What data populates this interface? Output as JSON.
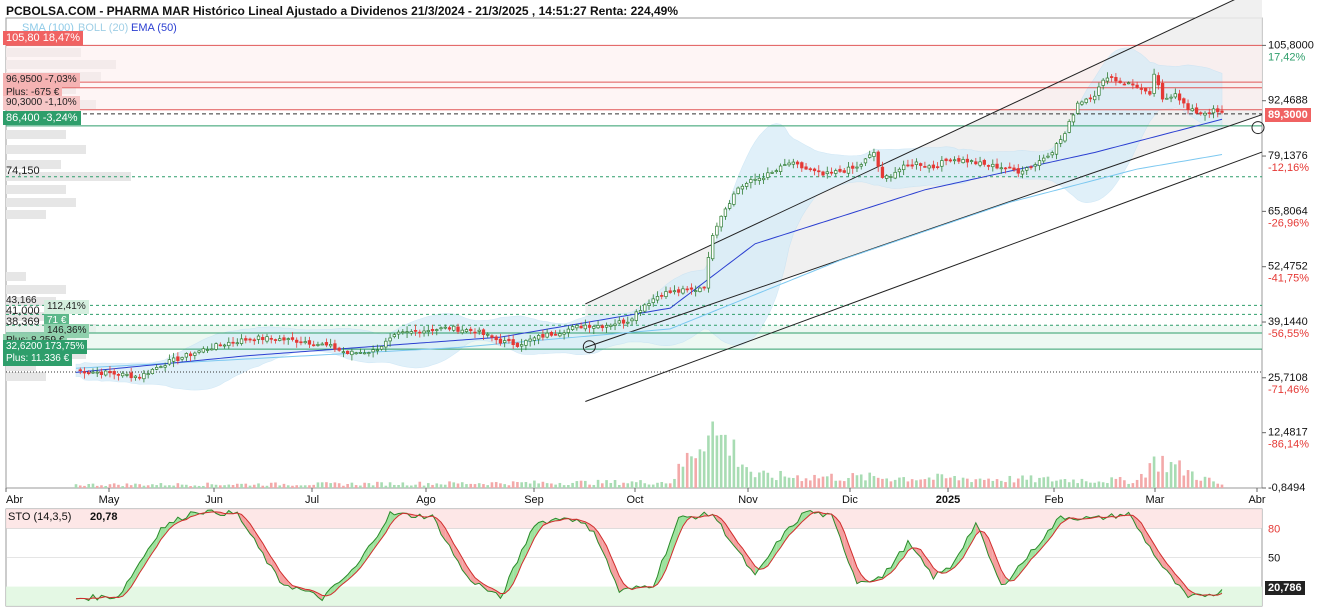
{
  "header": {
    "title": "PCBOLSA.COM - PHARMA MAR Histórico Lineal Ajustado a Dividenos 21/3/2024 - 21/3/2025 , 14:51:27 Renta: 224,49%"
  },
  "indicators": {
    "sma": "SMA (100)",
    "boll": "BOLL (20)",
    "ema": "EMA (50)"
  },
  "colors": {
    "up": "#2e7d32",
    "down": "#e53935",
    "ema": "#2b3fd1",
    "sma": "#7cc8f0",
    "boll": "#bfe2f5",
    "accent_green": "#2e9e6b",
    "accent_red": "#f06262"
  },
  "tags": {
    "top_red": "105,80  18,47%",
    "p_96": "96,9500  -7,03%",
    "plus_675": "Plus: -675 €",
    "p_90": "90,3000  -1,10%",
    "current_green": "86,400  -3,24%",
    "p_74": "74,150",
    "p_43": "43,166",
    "pct_112": "112,41%",
    "p_41": "41,000",
    "p_38": "38,369",
    "pct_71": "71 €",
    "pct_146": "146,36%",
    "plus_8259": "Plus: 8.259 €",
    "p_32": "32,6200  173,75%",
    "plus_11336": "Plus: 11.336 €",
    "right_current": "89,3000"
  },
  "right_axis": {
    "labels": [
      {
        "value": "105,8000",
        "pct": "17,42%",
        "pct_color": "green"
      },
      {
        "value": "92,4688",
        "pct": "2,62%",
        "pct_color": "green"
      },
      {
        "value": "79,1376",
        "pct": "-12,16%",
        "pct_color": "red"
      },
      {
        "value": "65,8064",
        "pct": "-26,96%",
        "pct_color": "red"
      },
      {
        "value": "52,4752",
        "pct": "-41,75%",
        "pct_color": "red"
      },
      {
        "value": "39,1440",
        "pct": "-56,55%",
        "pct_color": "red"
      },
      {
        "value": "25,7108",
        "pct": "-71,46%",
        "pct_color": "red"
      },
      {
        "value": "12,4817",
        "pct": "-86,14%",
        "pct_color": "red"
      },
      {
        "value": "-0,8494",
        "pct": "",
        "pct_color": "red"
      }
    ]
  },
  "x_axis": {
    "labels": [
      "Abr",
      "May",
      "Jun",
      "Jul",
      "Ago",
      "Sep",
      "Oct",
      "Nov",
      "Dic",
      "2025",
      "Feb",
      "Mar",
      "Abr"
    ]
  },
  "stochastic": {
    "label": "STO (14,3,5)",
    "value": "20,78",
    "right_value": "20,786",
    "levels": [
      "80",
      "50"
    ]
  },
  "chart_data": {
    "type": "line",
    "title": "PHARMA MAR Histórico Lineal Ajustado a Dividenos",
    "ylim": [
      -0.8494,
      112.4
    ],
    "price_anchors": [
      [
        0,
        27.5
      ],
      [
        8,
        26.8
      ],
      [
        15,
        26.0
      ],
      [
        20,
        28.8
      ],
      [
        24,
        30.3
      ],
      [
        30,
        32.5
      ],
      [
        36,
        34.2
      ],
      [
        42,
        35.3
      ],
      [
        48,
        35.0
      ],
      [
        54,
        34.5
      ],
      [
        60,
        33.2
      ],
      [
        64,
        31.6
      ],
      [
        70,
        32.2
      ],
      [
        76,
        36.2
      ],
      [
        82,
        37.2
      ],
      [
        88,
        37.7
      ],
      [
        94,
        37.0
      ],
      [
        100,
        34.5
      ],
      [
        104,
        33.8
      ],
      [
        110,
        35.8
      ],
      [
        116,
        37.4
      ],
      [
        120,
        38.4
      ],
      [
        124,
        38.3
      ],
      [
        130,
        39.5
      ],
      [
        134,
        43.4
      ],
      [
        138,
        46.1
      ],
      [
        142,
        46.5
      ],
      [
        146,
        47.0
      ],
      [
        148,
        48.0
      ],
      [
        150,
        60.5
      ],
      [
        152,
        65.0
      ],
      [
        156,
        71.5
      ],
      [
        160,
        73.5
      ],
      [
        164,
        75.0
      ],
      [
        168,
        77.5
      ],
      [
        172,
        76.0
      ],
      [
        176,
        74.5
      ],
      [
        180,
        75.5
      ],
      [
        184,
        76.3
      ],
      [
        188,
        80.0
      ],
      [
        190,
        73.5
      ],
      [
        194,
        76.0
      ],
      [
        198,
        77.5
      ],
      [
        202,
        76.5
      ],
      [
        206,
        78.5
      ],
      [
        210,
        78.0
      ],
      [
        214,
        77.0
      ],
      [
        218,
        76.5
      ],
      [
        222,
        75.5
      ],
      [
        226,
        77.2
      ],
      [
        230,
        80.5
      ],
      [
        233,
        84.5
      ],
      [
        236,
        92.0
      ],
      [
        240,
        94.0
      ],
      [
        243,
        98.5
      ],
      [
        246,
        97.0
      ],
      [
        250,
        96.0
      ],
      [
        253,
        93.5
      ],
      [
        254,
        99.0
      ],
      [
        256,
        92.5
      ],
      [
        259,
        94.5
      ],
      [
        262,
        90.2
      ],
      [
        265,
        89.5
      ],
      [
        268,
        90.0
      ],
      [
        270,
        89.3
      ]
    ],
    "n_sessions": 271,
    "ema50_anchors": [
      [
        0,
        27.0
      ],
      [
        40,
        31.0
      ],
      [
        100,
        35.5
      ],
      [
        140,
        42.5
      ],
      [
        160,
        58.0
      ],
      [
        200,
        71.0
      ],
      [
        240,
        80.0
      ],
      [
        270,
        88.0
      ]
    ],
    "sma100_anchors": [
      [
        0,
        28.0
      ],
      [
        90,
        33.0
      ],
      [
        140,
        37.5
      ],
      [
        180,
        54.0
      ],
      [
        220,
        68.0
      ],
      [
        250,
        76.0
      ],
      [
        270,
        79.5
      ]
    ],
    "volume_anchors": [
      [
        0,
        5
      ],
      [
        60,
        6
      ],
      [
        140,
        9
      ],
      [
        150,
        95
      ],
      [
        160,
        18
      ],
      [
        250,
        11
      ],
      [
        254,
        45
      ],
      [
        270,
        4
      ]
    ],
    "stochastic_anchors": [
      [
        0,
        8
      ],
      [
        10,
        10
      ],
      [
        20,
        80
      ],
      [
        28,
        98
      ],
      [
        38,
        95
      ],
      [
        48,
        25
      ],
      [
        58,
        8
      ],
      [
        66,
        40
      ],
      [
        74,
        95
      ],
      [
        84,
        92
      ],
      [
        92,
        30
      ],
      [
        100,
        8
      ],
      [
        108,
        85
      ],
      [
        116,
        92
      ],
      [
        122,
        78
      ],
      [
        128,
        15
      ],
      [
        136,
        22
      ],
      [
        142,
        90
      ],
      [
        150,
        95
      ],
      [
        160,
        30
      ],
      [
        166,
        70
      ],
      [
        172,
        98
      ],
      [
        178,
        92
      ],
      [
        184,
        25
      ],
      [
        190,
        30
      ],
      [
        196,
        65
      ],
      [
        202,
        30
      ],
      [
        206,
        40
      ],
      [
        212,
        85
      ],
      [
        218,
        20
      ],
      [
        224,
        50
      ],
      [
        232,
        92
      ],
      [
        240,
        90
      ],
      [
        248,
        95
      ],
      [
        256,
        40
      ],
      [
        262,
        8
      ],
      [
        270,
        15
      ]
    ],
    "horizontal_levels": [
      {
        "value": 105.8,
        "style": "solid-red"
      },
      {
        "value": 96.95,
        "style": "solid-red"
      },
      {
        "value": 95.6,
        "style": "solid-red"
      },
      {
        "value": 90.3,
        "style": "solid-red"
      },
      {
        "value": 89.3,
        "style": "dashed-dark"
      },
      {
        "value": 86.4,
        "style": "solid-green"
      },
      {
        "value": 74.15,
        "style": "dashed-green"
      },
      {
        "value": 43.166,
        "style": "dashed-green"
      },
      {
        "value": 41.0,
        "style": "dashed-green"
      },
      {
        "value": 38.369,
        "style": "dashed-green"
      },
      {
        "value": 36.5,
        "style": "solid-green"
      },
      {
        "value": 32.62,
        "style": "solid-green"
      },
      {
        "value": 27.1,
        "style": "dotted-dark"
      }
    ],
    "channel": {
      "upper": [
        [
          120,
          43.5
        ],
        [
          271,
          118.5
        ]
      ],
      "middle": [
        [
          120,
          33.0
        ],
        [
          271,
          88.5
        ]
      ],
      "lower": [
        [
          120,
          20.0
        ],
        [
          271,
          80.5
        ]
      ],
      "box_from_session": 120
    },
    "stochastic_levels": [
      80,
      50
    ],
    "legend_position": "top-left"
  }
}
